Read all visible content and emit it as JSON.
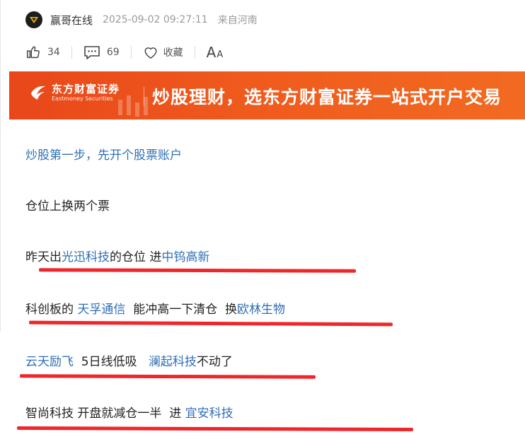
{
  "author": {
    "name": "赢哥在线",
    "time": "2025-09-02 09:27:11",
    "location": "来自河南"
  },
  "actions": {
    "likes": "34",
    "comments": "69",
    "favorite_label": "收藏",
    "font_big": "A",
    "font_small": "A"
  },
  "banner": {
    "brand_cn": "东方财富证券",
    "brand_en": "Eastmoney Securities",
    "slogan": "炒股理财，选东方财富证券一站式开户交易"
  },
  "content": {
    "promo_link": "炒股第一步，先开个股票账户",
    "p1": "仓位上换两个票",
    "p2": {
      "a": "昨天出",
      "link1": "光迅科技",
      "b": "的仓位 进",
      "link2": "中钨高新"
    },
    "p3": {
      "a": "科创板的 ",
      "link1": "天孚通信",
      "b": "  能冲高一下清仓  换",
      "link2": "欧林生物"
    },
    "p4": {
      "link1": "云天励飞",
      "a": "  5日线低吸   ",
      "link2": "澜起科技",
      "b": "不动了"
    },
    "p5": {
      "a": "智尚科技 开盘就减仓一半  进 ",
      "link1": "宜安科技"
    }
  },
  "colors": {
    "link": "#2f6fb5",
    "highlight": "#f0262b",
    "banner": "#ef5a1d"
  }
}
